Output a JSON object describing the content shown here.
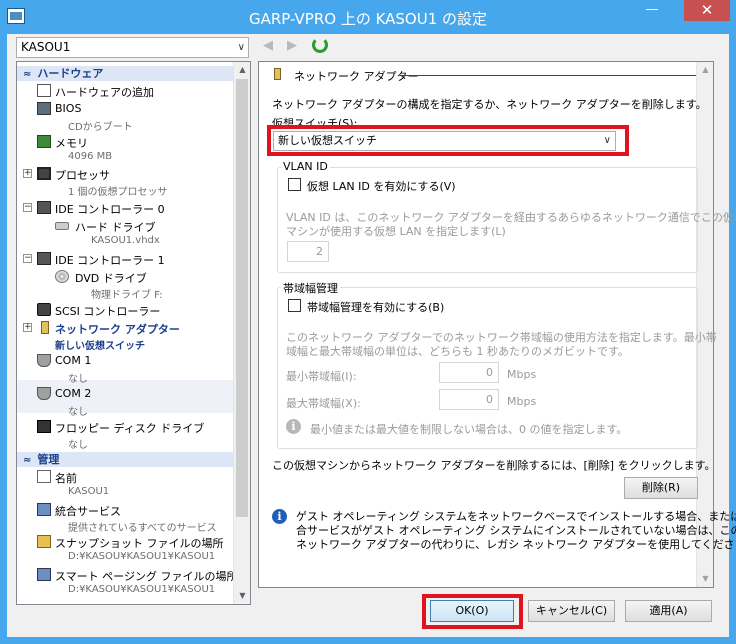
{
  "window": {
    "title": "GARP-VPRO 上の KASOU1 の設定",
    "minimize_glyph": "—",
    "close_glyph": "✕"
  },
  "vm_selector": {
    "value": "KASOU1",
    "arrow": "∨"
  },
  "tree": {
    "hardware_header": "ハードウェア",
    "management_header": "管理",
    "header_chevron": "≈",
    "items": [
      {
        "label": "ハードウェアの追加",
        "sub": "",
        "icon": "add-hardware-icon"
      },
      {
        "label": "BIOS",
        "sub": "CDからブート",
        "icon": "bios-icon"
      },
      {
        "label": "メモリ",
        "sub": "4096 MB",
        "icon": "memory-icon"
      },
      {
        "label": "プロセッサ",
        "sub": "1 個の仮想プロセッサ",
        "icon": "processor-icon",
        "expander": "+"
      },
      {
        "label": "IDE コントローラー 0",
        "sub": "",
        "icon": "ide-controller-icon",
        "expander": "−"
      },
      {
        "label": "ハード ドライブ",
        "sub": "KASOU1.vhdx",
        "icon": "hard-drive-icon"
      },
      {
        "label": "IDE コントローラー 1",
        "sub": "",
        "icon": "ide-controller-icon",
        "expander": "−"
      },
      {
        "label": "DVD ドライブ",
        "sub": "物理ドライブ F:",
        "icon": "dvd-drive-icon"
      },
      {
        "label": "SCSI コントローラー",
        "sub": "",
        "icon": "scsi-controller-icon"
      },
      {
        "label": "ネットワーク アダプター",
        "sub": "新しい仮想スイッチ",
        "icon": "network-adapter-icon",
        "expander": "+",
        "selected": true
      },
      {
        "label": "COM 1",
        "sub": "なし",
        "icon": "com-port-icon"
      },
      {
        "label": "COM 2",
        "sub": "なし",
        "icon": "com-port-icon"
      },
      {
        "label": "フロッピー ディスク ドライブ",
        "sub": "なし",
        "icon": "floppy-drive-icon"
      }
    ],
    "mgmt_items": [
      {
        "label": "名前",
        "sub": "KASOU1",
        "icon": "name-icon"
      },
      {
        "label": "統合サービス",
        "sub": "提供されているすべてのサービス",
        "icon": "integration-services-icon"
      },
      {
        "label": "スナップショット ファイルの場所",
        "sub": "D:¥KASOU¥KASOU1¥KASOU1",
        "icon": "snapshot-location-icon"
      },
      {
        "label": "スマート ページング ファイルの場所",
        "sub": "D:¥KASOU¥KASOU1¥KASOU1",
        "icon": "smart-paging-icon"
      }
    ]
  },
  "nav": {
    "back": "◀",
    "forward": "▶"
  },
  "panel": {
    "header": "ネットワーク アダプター",
    "description": "ネットワーク アダプターの構成を指定するか、ネットワーク アダプターを削除します。",
    "switch_label": "仮想スイッチ(S):",
    "switch_value": "新しい仮想スイッチ",
    "switch_arrow": "∨",
    "vlan": {
      "group_label": "VLAN ID",
      "checkbox_label": "仮想 LAN ID を有効にする(V)",
      "help_line1": "VLAN ID は、このネットワーク アダプターを経由するあらゆるネットワーク通信でこの仮想",
      "help_line2": "マシンが使用する仮想 LAN を指定します(L)",
      "value": "2"
    },
    "bandwidth": {
      "group_label": "帯域幅管理",
      "checkbox_label": "帯域幅管理を有効にする(B)",
      "help_line1": "このネットワーク アダプターでのネットワーク帯域幅の使用方法を指定します。最小帯",
      "help_line2": "域幅と最大帯域幅の単位は、どちらも 1 秒あたりのメガビットです。",
      "min_label": "最小帯域幅(I):",
      "min_value": "0",
      "max_label": "最大帯域幅(X):",
      "max_value": "0",
      "unit": "Mbps",
      "note": "最小値または最大値を制限しない場合は、0 の値を指定します。"
    },
    "remove_text": "この仮想マシンからネットワーク アダプターを削除するには、[削除] をクリックします。",
    "remove_button": "削除(R)",
    "info_line1": "ゲスト オペレーティング システムをネットワークベースでインストールする場合、または統",
    "info_line2": "合サービスがゲスト オペレーティング システムにインストールされていない場合は、この",
    "info_line3": "ネットワーク アダプターの代わりに、レガシ ネットワーク アダプターを使用してください。",
    "info_glyph": "i"
  },
  "buttons": {
    "ok": "OK(O)",
    "cancel": "キャンセル(C)",
    "apply": "適用(A)"
  },
  "scroll": {
    "up": "▲",
    "down": "▼"
  },
  "colors": {
    "title_bar": "#46a7ec",
    "highlight": "#e0141e",
    "selected_text": "#1c3f8c"
  }
}
